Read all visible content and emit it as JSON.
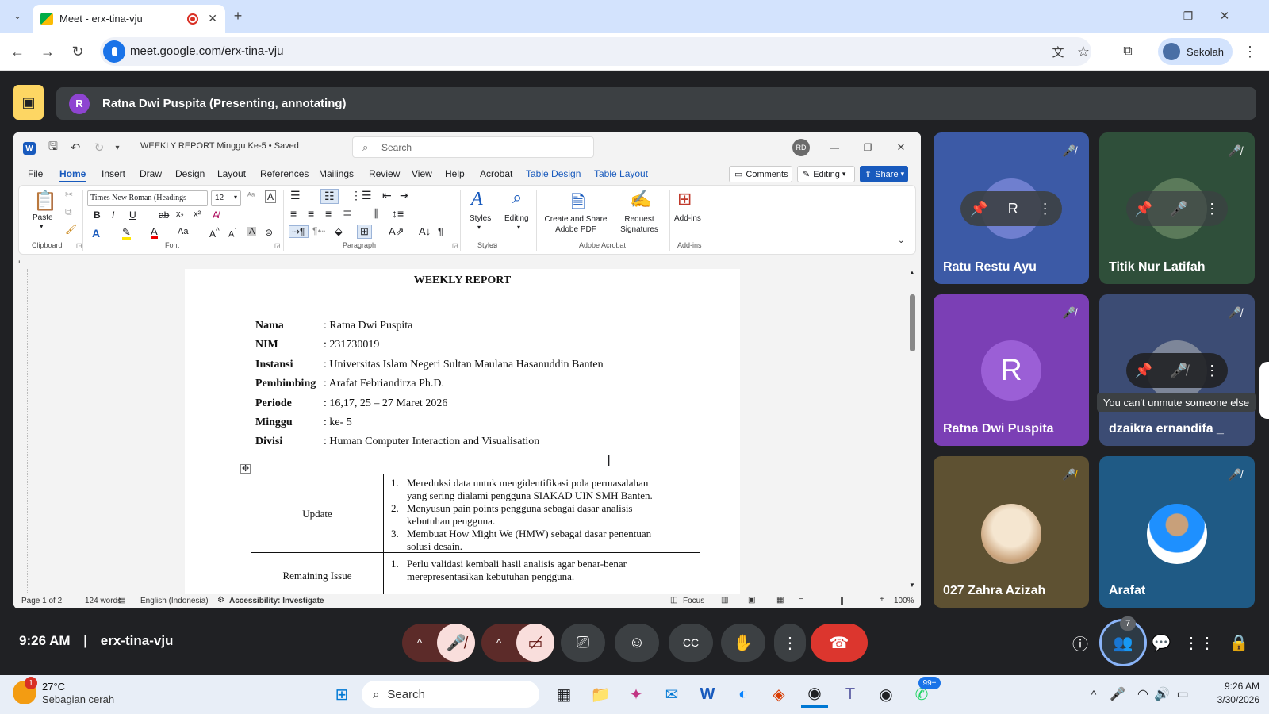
{
  "browser": {
    "tab_title": "Meet - erx-tina-vju",
    "url": "meet.google.com/erx-tina-vju",
    "profile": "Sekolah"
  },
  "meet": {
    "presenter_banner": "Ratna Dwi Puspita (Presenting, annotating)",
    "presenter_initial": "R",
    "time": "9:26 AM",
    "divider": "|",
    "meeting_code": "erx-tina-vju",
    "participants_count": "7",
    "tooltip": "You can't unmute someone else",
    "participants": [
      {
        "name": "Ratu Restu Ayu",
        "initial": "R"
      },
      {
        "name": "Titik Nur Latifah"
      },
      {
        "name": "Ratna Dwi Puspita",
        "initial": "R"
      },
      {
        "name": "dzaikra ernandifa _"
      },
      {
        "name": "027 Zahra Azizah"
      },
      {
        "name": "Arafat"
      }
    ]
  },
  "word": {
    "doc_title": "WEEKLY REPORT Minggu Ke-5 • Saved",
    "search_placeholder": "Search",
    "user_initials": "RD",
    "menu": [
      "File",
      "Home",
      "Insert",
      "Draw",
      "Design",
      "Layout",
      "References",
      "Mailings",
      "Review",
      "View",
      "Help",
      "Acrobat",
      "Table Design",
      "Table Layout"
    ],
    "comments": "Comments",
    "editing": "Editing",
    "share": "Share",
    "font_name": "Times New Roman (Headings",
    "font_size": "12",
    "paste": "Paste",
    "groups": {
      "clipboard": "Clipboard",
      "font": "Font",
      "paragraph": "Paragraph",
      "styles": "Styles",
      "acrobat": "Adobe Acrobat",
      "addins": "Add-ins"
    },
    "styles": "Styles",
    "editing_btn": "Editing",
    "create_pdf": "Create and Share Adobe PDF",
    "request_sig": "Request Signatures",
    "addins": "Add-ins",
    "status": {
      "page": "Page 1 of 2",
      "words": "124 words",
      "language": "English (Indonesia)",
      "accessibility": "Accessibility: Investigate",
      "focus": "Focus",
      "zoom": "100%"
    }
  },
  "document": {
    "title": "WEEKLY REPORT",
    "fields": [
      {
        "key": "Nama",
        "value": ": Ratna Dwi Puspita"
      },
      {
        "key": "NIM",
        "value": ": 231730019"
      },
      {
        "key": "Instansi",
        "value": ": Universitas Islam Negeri Sultan Maulana Hasanuddin Banten"
      },
      {
        "key": "Pembimbing",
        "value": ": Arafat Febriandirza Ph.D."
      },
      {
        "key": "Periode",
        "value": ": 16,17, 25 – 27 Maret 2026"
      },
      {
        "key": "Minggu",
        "value": ": ke- 5"
      },
      {
        "key": "Divisi",
        "value": ": Human Computer Interaction and Visualisation"
      }
    ],
    "table": {
      "update_label": "Update",
      "update_items": [
        {
          "n": "1.",
          "l1": "Mereduksi data untuk mengidentifikasi pola permasalahan",
          "l2": "yang sering dialami pengguna SIAKAD UIN SMH Banten."
        },
        {
          "n": "2.",
          "l1": "Menyusun pain points pengguna sebagai dasar analisis",
          "l2": "kebutuhan pengguna."
        },
        {
          "n": "3.",
          "l1": "Membuat How Might We (HMW) sebagai dasar penentuan",
          "l2": "solusi desain."
        }
      ],
      "issue_label": "Remaining Issue",
      "issue_items": [
        {
          "n": "1.",
          "l1": "Perlu validasi kembali hasil analisis agar benar-benar",
          "l2": "merepresentasikan kebutuhan pengguna."
        }
      ]
    }
  },
  "taskbar": {
    "weather_temp": "27°C",
    "weather_desc": "Sebagian cerah",
    "weather_badge": "1",
    "search": "Search",
    "whatsapp_badge": "99+",
    "time": "9:26 AM",
    "date": "3/30/2026"
  }
}
